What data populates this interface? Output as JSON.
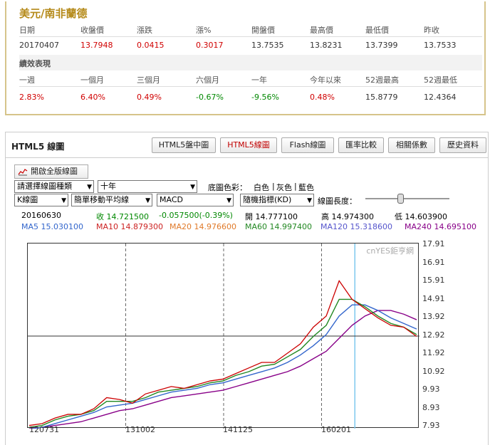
{
  "quote": {
    "title": "美元/南非蘭德",
    "headers": [
      "日期",
      "收盤價",
      "漲跌",
      "漲%",
      "開盤價",
      "最高價",
      "最低價",
      "昨收"
    ],
    "values": [
      "20170407",
      "13.7948",
      "0.0415",
      "0.3017",
      "13.7535",
      "13.8231",
      "13.7399",
      "13.7533"
    ],
    "perf_title": "績效表現",
    "perf_headers": [
      "一週",
      "一個月",
      "三個月",
      "六個月",
      "一年",
      "今年以來",
      "52週最高",
      "52週最低"
    ],
    "perf_values": [
      "2.83%",
      "6.40%",
      "0.49%",
      "-0.67%",
      "-9.56%",
      "0.48%",
      "15.8779",
      "12.4364"
    ]
  },
  "chart_panel": {
    "title": "HTML5 線圖",
    "tabs": [
      "HTML5盤中圖",
      "HTML5線圖",
      "Flash線圖",
      "匯率比較",
      "相關係數",
      "歷史資料"
    ],
    "active_tab": "HTML5線圖",
    "full_button": "開啟全版線圖",
    "select_type": "請選擇線圖種類",
    "select_period": "十年",
    "bg_label": "底圖色彩：",
    "bg_white": "白色",
    "bg_gray": "灰色",
    "bg_blue": "藍色",
    "sep": "|",
    "select_kline": "K線圖",
    "select_ma": "簡單移動平均線",
    "select_macd": "MACD",
    "select_kd": "隨機指標(KD)",
    "length_label": "線圖長度：",
    "date": "20160630",
    "close": "收 14.721500",
    "change": "-0.057500(-0.39%)",
    "open": "開 14.777100",
    "high": "高 14.974300",
    "low": "低 14.603900",
    "ma5": "MA5 15.030100",
    "ma10": "MA10 14.879300",
    "ma20": "MA20 14.976600",
    "ma60": "MA60 14.997400",
    "ma120": "MA120 15.318600",
    "ma240": "MA240 14.695100",
    "watermark": "cnYES鉅亨網"
  },
  "chart_data": {
    "type": "line",
    "y_ticks": [
      "17.91",
      "16.91",
      "15.91",
      "14.91",
      "13.92",
      "12.92",
      "11.92",
      "10.92",
      "9.93",
      "8.93",
      "7.93"
    ],
    "ylim": [
      7.93,
      17.91
    ],
    "x_ticks": [
      "120731",
      "131002",
      "141125",
      "160201"
    ],
    "horizontal_line": 12.92,
    "series": [
      {
        "name": "K",
        "color": "#cc0000",
        "values": [
          8.1,
          8.2,
          8.5,
          8.7,
          8.7,
          9.0,
          9.6,
          9.5,
          9.3,
          9.8,
          10.0,
          10.2,
          10.1,
          10.3,
          10.5,
          10.6,
          10.9,
          11.2,
          11.5,
          11.5,
          12.0,
          12.5,
          13.4,
          14.0,
          15.9,
          14.9,
          14.4,
          13.9,
          13.5,
          13.4,
          12.9
        ]
      },
      {
        "name": "MA20",
        "color": "#228822",
        "values": [
          8.0,
          8.1,
          8.4,
          8.6,
          8.7,
          8.9,
          9.4,
          9.4,
          9.4,
          9.6,
          9.9,
          10.0,
          10.1,
          10.2,
          10.4,
          10.5,
          10.8,
          11.0,
          11.3,
          11.4,
          11.8,
          12.2,
          12.9,
          13.5,
          14.9,
          14.9,
          14.5,
          14.0,
          13.6,
          13.4,
          13.0
        ]
      },
      {
        "name": "MA60",
        "color": "#3366cc",
        "values": [
          7.9,
          8.0,
          8.2,
          8.4,
          8.6,
          8.8,
          9.1,
          9.2,
          9.3,
          9.5,
          9.7,
          9.9,
          10.0,
          10.1,
          10.3,
          10.4,
          10.6,
          10.8,
          11.0,
          11.2,
          11.5,
          11.9,
          12.4,
          13.0,
          14.0,
          14.6,
          14.6,
          14.3,
          13.9,
          13.6,
          13.3
        ]
      },
      {
        "name": "MA240",
        "color": "#880088",
        "values": [
          7.93,
          8.0,
          8.1,
          8.2,
          8.3,
          8.5,
          8.7,
          8.9,
          9.0,
          9.2,
          9.4,
          9.6,
          9.7,
          9.8,
          9.9,
          10.0,
          10.2,
          10.4,
          10.6,
          10.8,
          11.0,
          11.3,
          11.7,
          12.1,
          12.8,
          13.5,
          14.0,
          14.3,
          14.3,
          14.1,
          13.8
        ]
      }
    ]
  }
}
